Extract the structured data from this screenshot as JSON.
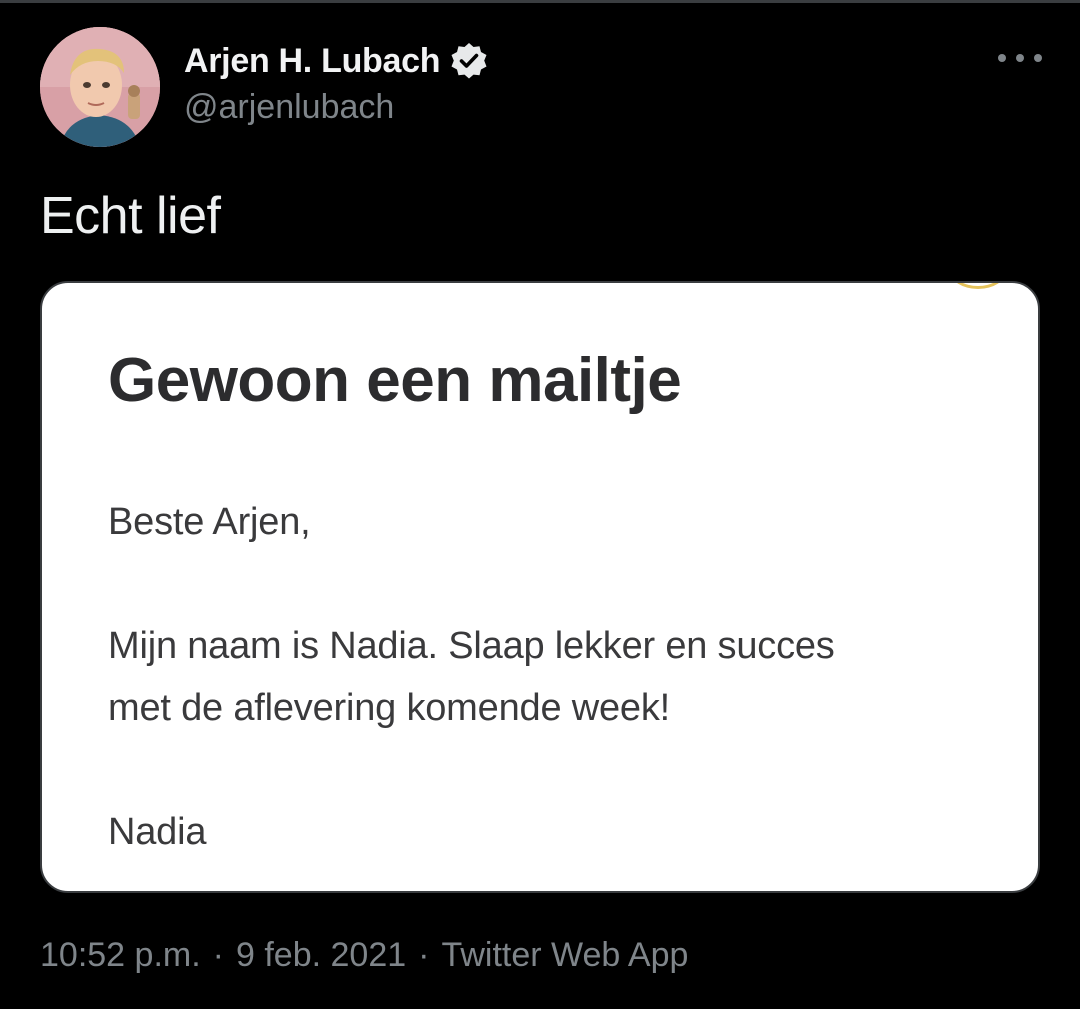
{
  "tweet": {
    "author": {
      "display_name": "Arjen H. Lubach",
      "handle": "@arjenlubach",
      "verified_icon": "verified-badge-icon"
    },
    "more_icon": "more-horizontal-icon",
    "text": "Echt lief",
    "media": {
      "title": "Gewoon een mailtje",
      "lines": [
        "Beste Arjen,",
        "Mijn naam is Nadia. Slaap lekker en succes",
        "met de aflevering komende week!",
        "Nadia"
      ]
    },
    "meta": {
      "time": "10:52 p.m.",
      "separator": "·",
      "date": "9 feb. 2021",
      "source": "Twitter Web App"
    }
  },
  "colors": {
    "background": "#000000",
    "secondary_text": "#7f858a",
    "primary_text": "#e7e9ea"
  }
}
